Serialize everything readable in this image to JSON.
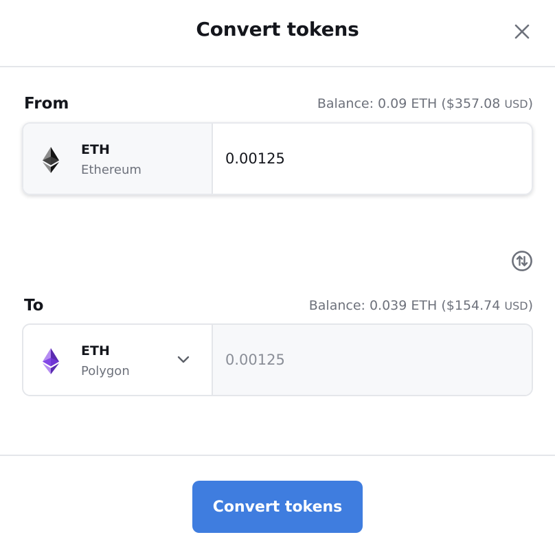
{
  "dialog": {
    "title": "Convert tokens",
    "close_icon": "close-icon"
  },
  "from": {
    "label": "From",
    "balance_prefix": "Balance: ",
    "balance_amount": "0.09 ETH",
    "balance_usd_value": "$357.08",
    "balance_usd_unit": "USD",
    "token": {
      "symbol": "ETH",
      "network": "Ethereum",
      "icon": "ethereum-icon",
      "icon_color": "#3c3c3d"
    },
    "amount": "0.00125"
  },
  "swap": {
    "icon": "swap-direction-icon"
  },
  "to": {
    "label": "To",
    "balance_prefix": "Balance: ",
    "balance_amount": "0.039 ETH",
    "balance_usd_value": "$154.74",
    "balance_usd_unit": "USD",
    "token": {
      "symbol": "ETH",
      "network": "Polygon",
      "icon": "ethereum-polygon-icon",
      "icon_color": "#8247e5",
      "dropdown_icon": "chevron-down-icon"
    },
    "amount": "0.00125"
  },
  "footer": {
    "convert_label": "Convert tokens"
  },
  "colors": {
    "accent": "#3f7ddf",
    "muted_text": "#6d717b",
    "border": "#e4e6ea"
  }
}
